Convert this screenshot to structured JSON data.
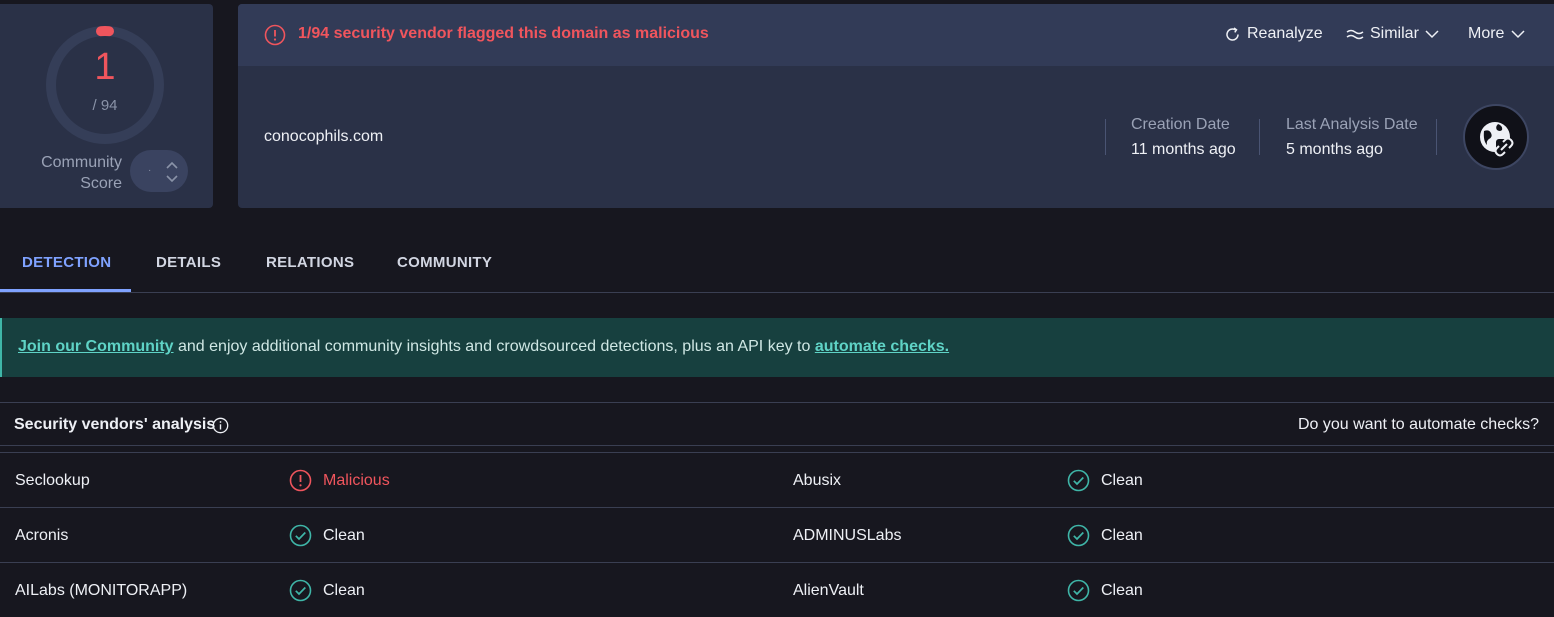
{
  "score": {
    "detections": "1",
    "total": "/ 94",
    "community_label": "Community Score",
    "community_vote": "·"
  },
  "alert": {
    "text": "1/94 security vendor flagged this domain as malicious",
    "color": "#f0555d"
  },
  "actions": {
    "reanalyze": "Reanalyze",
    "similar": "Similar",
    "more": "More"
  },
  "domain": {
    "name": "conocophils.com",
    "creation_label": "Creation Date",
    "creation_value": "11 months ago",
    "analysis_label": "Last Analysis Date",
    "analysis_value": "5 months ago",
    "icon": "globe-link-icon"
  },
  "tabs": [
    {
      "label": "DETECTION",
      "active": true
    },
    {
      "label": "DETAILS",
      "active": false
    },
    {
      "label": "RELATIONS",
      "active": false
    },
    {
      "label": "COMMUNITY",
      "active": false
    }
  ],
  "banner": {
    "link1": "Join our Community",
    "text": " and enjoy additional community insights and crowdsourced detections, plus an API key to ",
    "link2": "automate checks."
  },
  "vendors": {
    "title": "Security vendors' analysis",
    "automate_question": "Do you want to automate checks?",
    "rows": [
      {
        "left_name": "Seclookup",
        "left_status": "Malicious",
        "right_name": "Abusix",
        "right_status": "Clean"
      },
      {
        "left_name": "Acronis",
        "left_status": "Clean",
        "right_name": "ADMINUSLabs",
        "right_status": "Clean"
      },
      {
        "left_name": "AILabs (MONITORAPP)",
        "left_status": "Clean",
        "right_name": "AlienVault",
        "right_status": "Clean"
      }
    ]
  },
  "colors": {
    "malicious": "#f0555d",
    "clean": "#3fb6a8",
    "accent": "#7fa2ff",
    "panel": "#2a3147",
    "background": "#17171f"
  }
}
